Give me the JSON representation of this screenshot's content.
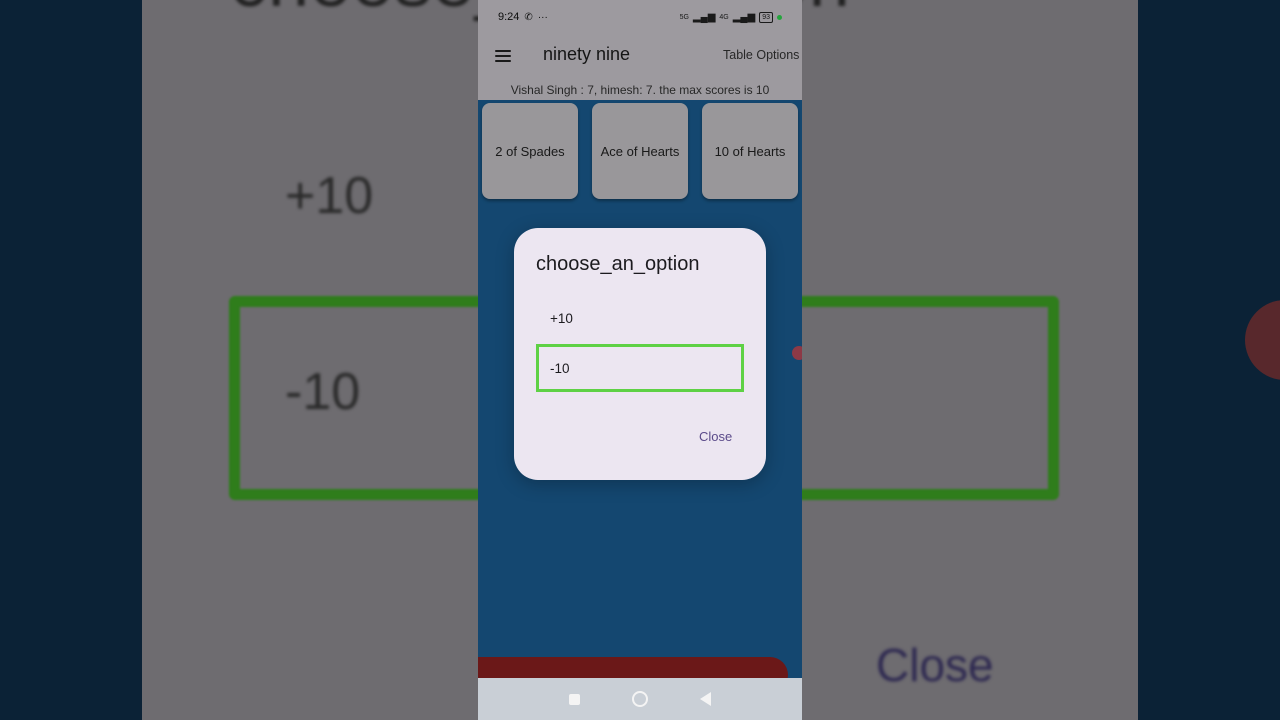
{
  "background": {
    "zoom_title": "choose_an_option",
    "zoom_option_plus": "+10",
    "zoom_option_minus": "-10",
    "zoom_close": "Close"
  },
  "status_bar": {
    "time": "9:24",
    "icons_left": [
      "whatsapp-icon",
      "more-dots-icon"
    ],
    "network_1": "5G",
    "network_2": "4G",
    "battery": "93"
  },
  "app_bar": {
    "title": "ninety nine",
    "table_options": "Table Options"
  },
  "score_line": "Vishal Singh : 7, himesh: 7. the max scores is 10",
  "cards": [
    {
      "label": "2 of Spades"
    },
    {
      "label": "Ace of Hearts"
    },
    {
      "label": "10 of Hearts"
    }
  ],
  "dialog": {
    "title": "choose_an_option",
    "options": [
      {
        "label": "+10",
        "selected": false
      },
      {
        "label": "-10",
        "selected": true
      }
    ],
    "close_label": "Close"
  },
  "colors": {
    "table_blue": "#1a5c90",
    "selection_green": "#5ed145",
    "dialog_bg": "#ece6f1",
    "accent_purple": "#5b4b8a"
  }
}
